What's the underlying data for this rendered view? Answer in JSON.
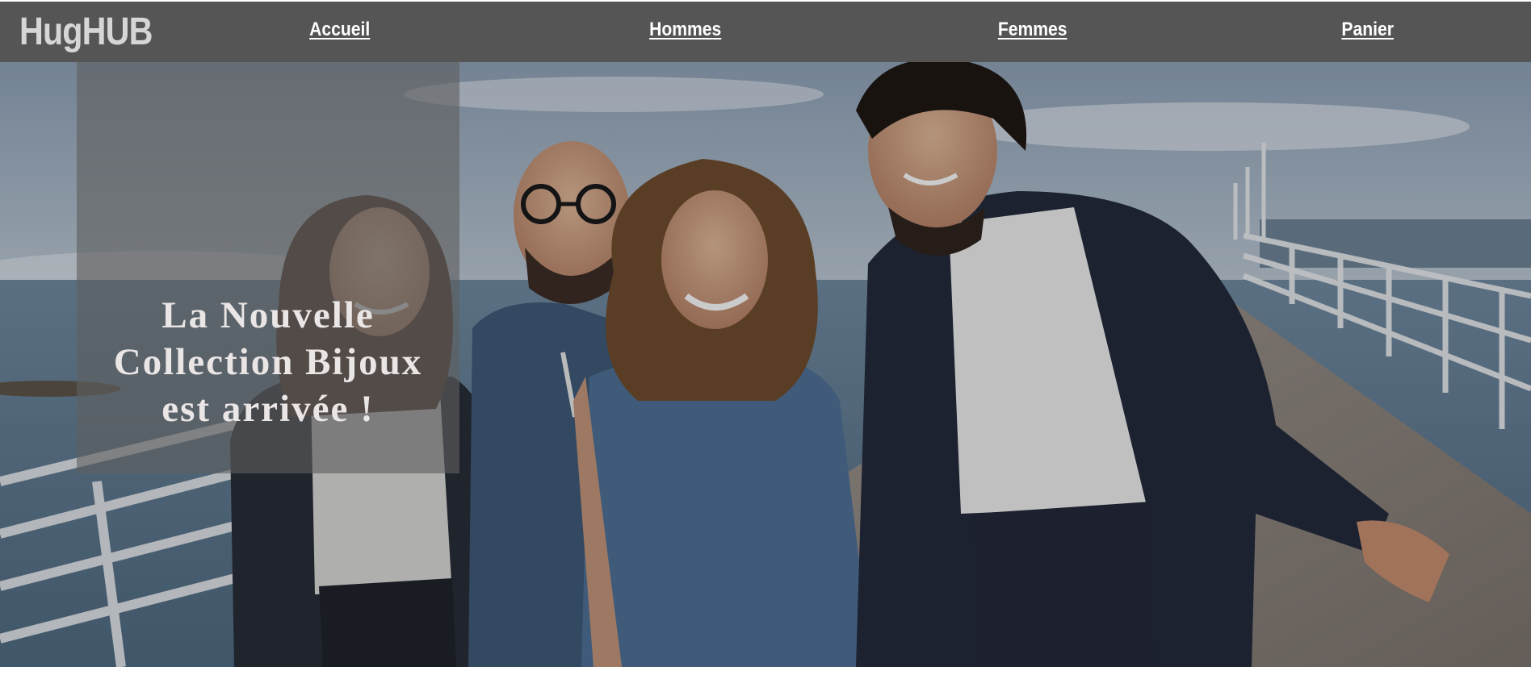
{
  "header": {
    "logo": "HugHUB",
    "nav": {
      "accueil": "Accueil",
      "hommes": "Hommes",
      "femmes": "Femmes",
      "panier": "Panier"
    }
  },
  "hero": {
    "headline": {
      "line1": "La Nouvelle",
      "line2": "Collection Bijoux",
      "line3": "est arrivée !"
    }
  },
  "colors": {
    "navbar": "#555555",
    "logo": "#d6d6d6",
    "nav_link": "#ffffff",
    "caption_box": "rgba(95,95,95,0.62)",
    "caption_text": "#ebe6e6"
  }
}
